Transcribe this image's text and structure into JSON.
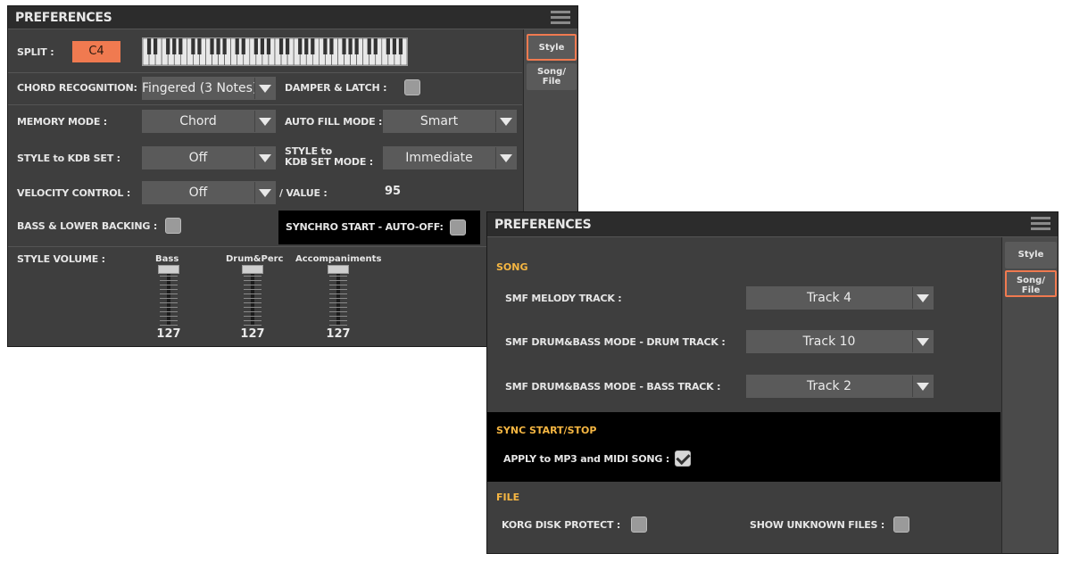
{
  "panel1": {
    "title": "PREFERENCES",
    "split": {
      "label": "SPLIT :",
      "note": "C4"
    },
    "chord_recognition": {
      "label": "CHORD RECOGNITION:",
      "value": "Fingered (3 Notes)"
    },
    "damper_latch": {
      "label": "DAMPER & LATCH :",
      "checked": false
    },
    "memory_mode": {
      "label": "MEMORY MODE :",
      "value": "Chord"
    },
    "auto_fill_mode": {
      "label": "AUTO FILL MODE :",
      "value": "Smart"
    },
    "style_kbd_set": {
      "label": "STYLE to KDB SET :",
      "value": "Off"
    },
    "style_kbd_set_mode": {
      "label_line1": "STYLE to",
      "label_line2": "KDB SET MODE :",
      "value": "Immediate"
    },
    "velocity_control": {
      "label": "VELOCITY CONTROL :",
      "value": "Off"
    },
    "velocity_value": {
      "label": "/  VALUE :",
      "value": "95"
    },
    "bass_lower_backing": {
      "label": "BASS & LOWER BACKING :",
      "checked": false
    },
    "synchro_start": {
      "label": "SYNCHRO START - AUTO-OFF:",
      "checked": false
    },
    "style_volume": {
      "label": "STYLE VOLUME :",
      "faders": [
        {
          "name": "Bass",
          "value": "127"
        },
        {
          "name": "Drum&Perc",
          "value": "127"
        },
        {
          "name": "Accompaniments",
          "value": "127"
        }
      ]
    },
    "tabs": [
      {
        "label": "Style",
        "selected": true
      },
      {
        "label": "Song/ File",
        "selected": false
      }
    ]
  },
  "panel2": {
    "title": "PREFERENCES",
    "song_section": "SONG",
    "smf_melody": {
      "label": "SMF MELODY TRACK :",
      "value": "Track 4"
    },
    "smf_drum": {
      "label": "SMF DRUM&BASS MODE - DRUM TRACK :",
      "value": "Track 10"
    },
    "smf_bass": {
      "label": "SMF DRUM&BASS MODE - BASS TRACK :",
      "value": "Track 2"
    },
    "sync_section": "SYNC START/STOP",
    "apply_mp3": {
      "label": "APPLY to MP3 and MIDI SONG :",
      "checked": true
    },
    "file_section": "FILE",
    "korg_disk": {
      "label": "KORG DISK PROTECT :",
      "checked": false
    },
    "show_unknown": {
      "label": "SHOW UNKNOWN FILES :",
      "checked": false
    },
    "tabs": [
      {
        "label": "Style",
        "selected": false
      },
      {
        "label": "Song/ File",
        "selected": true
      }
    ]
  },
  "colors": {
    "accent": "#f07a50",
    "section": "#f5b642",
    "panel": "#3e3e3e"
  },
  "icons": [
    "menu-icon",
    "dropdown-arrow-icon",
    "checkbox-icon",
    "keyboard-icon",
    "fader-icon"
  ]
}
